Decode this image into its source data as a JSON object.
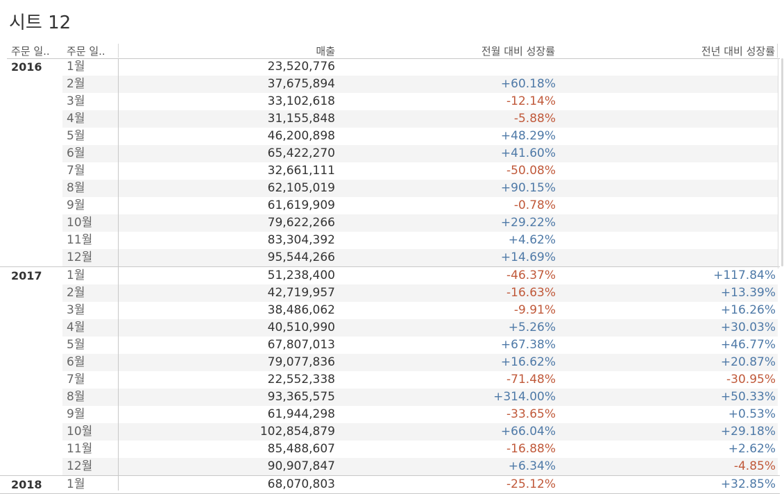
{
  "sheet": {
    "title": "시트 12"
  },
  "headers": {
    "col1": "주문 일..",
    "col2": "주문 일..",
    "sales": "매출",
    "mom": "전월 대비 성장률",
    "yoy": "전년 대비 성장률"
  },
  "colors": {
    "positive": "#4e79a7",
    "negative": "#c0593a",
    "stripe": "#f4f4f4"
  },
  "years": [
    {
      "year": "2016",
      "rows": [
        {
          "month": "1월",
          "sales": "23,520,776",
          "mom": "",
          "yoy": ""
        },
        {
          "month": "2월",
          "sales": "37,675,894",
          "mom": "+60.18%",
          "yoy": ""
        },
        {
          "month": "3월",
          "sales": "33,102,618",
          "mom": "-12.14%",
          "yoy": ""
        },
        {
          "month": "4월",
          "sales": "31,155,848",
          "mom": "-5.88%",
          "yoy": ""
        },
        {
          "month": "5월",
          "sales": "46,200,898",
          "mom": "+48.29%",
          "yoy": ""
        },
        {
          "month": "6월",
          "sales": "65,422,270",
          "mom": "+41.60%",
          "yoy": ""
        },
        {
          "month": "7월",
          "sales": "32,661,111",
          "mom": "-50.08%",
          "yoy": ""
        },
        {
          "month": "8월",
          "sales": "62,105,019",
          "mom": "+90.15%",
          "yoy": ""
        },
        {
          "month": "9월",
          "sales": "61,619,909",
          "mom": "-0.78%",
          "yoy": ""
        },
        {
          "month": "10월",
          "sales": "79,622,266",
          "mom": "+29.22%",
          "yoy": ""
        },
        {
          "month": "11월",
          "sales": "83,304,392",
          "mom": "+4.62%",
          "yoy": ""
        },
        {
          "month": "12월",
          "sales": "95,544,266",
          "mom": "+14.69%",
          "yoy": ""
        }
      ]
    },
    {
      "year": "2017",
      "rows": [
        {
          "month": "1월",
          "sales": "51,238,400",
          "mom": "-46.37%",
          "yoy": "+117.84%"
        },
        {
          "month": "2월",
          "sales": "42,719,957",
          "mom": "-16.63%",
          "yoy": "+13.39%"
        },
        {
          "month": "3월",
          "sales": "38,486,062",
          "mom": "-9.91%",
          "yoy": "+16.26%"
        },
        {
          "month": "4월",
          "sales": "40,510,990",
          "mom": "+5.26%",
          "yoy": "+30.03%"
        },
        {
          "month": "5월",
          "sales": "67,807,013",
          "mom": "+67.38%",
          "yoy": "+46.77%"
        },
        {
          "month": "6월",
          "sales": "79,077,836",
          "mom": "+16.62%",
          "yoy": "+20.87%"
        },
        {
          "month": "7월",
          "sales": "22,552,338",
          "mom": "-71.48%",
          "yoy": "-30.95%"
        },
        {
          "month": "8월",
          "sales": "93,365,575",
          "mom": "+314.00%",
          "yoy": "+50.33%"
        },
        {
          "month": "9월",
          "sales": "61,944,298",
          "mom": "-33.65%",
          "yoy": "+0.53%"
        },
        {
          "month": "10월",
          "sales": "102,854,879",
          "mom": "+66.04%",
          "yoy": "+29.18%"
        },
        {
          "month": "11월",
          "sales": "85,488,607",
          "mom": "-16.88%",
          "yoy": "+2.62%"
        },
        {
          "month": "12월",
          "sales": "90,907,847",
          "mom": "+6.34%",
          "yoy": "-4.85%"
        }
      ]
    },
    {
      "year": "2018",
      "rows": [
        {
          "month": "1월",
          "sales": "68,070,803",
          "mom": "-25.12%",
          "yoy": "+32.85%"
        }
      ]
    }
  ]
}
